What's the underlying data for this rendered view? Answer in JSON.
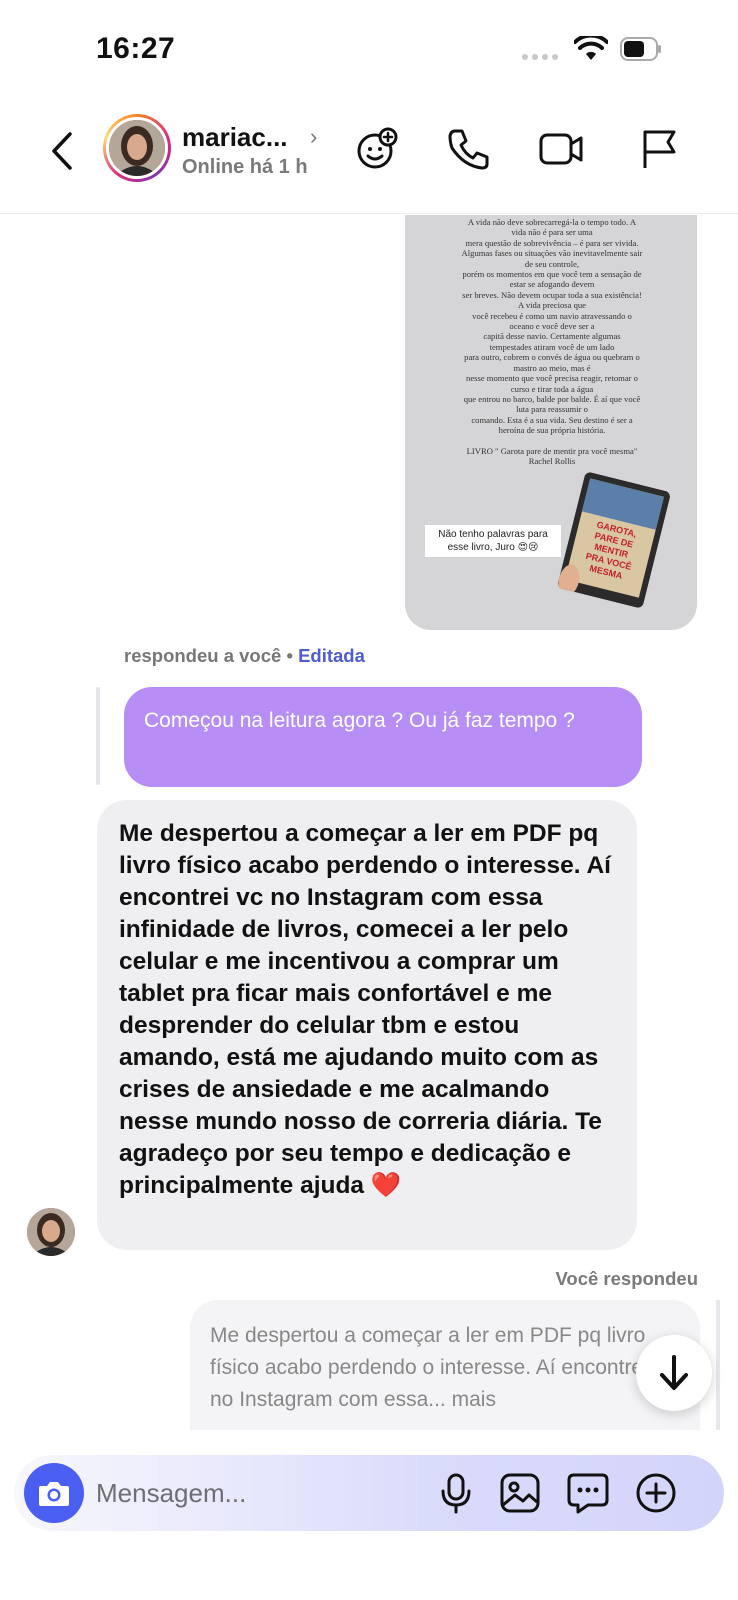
{
  "status_bar": {
    "time": "16:27"
  },
  "header": {
    "contact_name": "mariac...",
    "contact_status": "Online há 1 h",
    "icons": [
      "back-icon",
      "avatar",
      "sticker-icon",
      "phone-icon",
      "video-icon",
      "flag-icon"
    ]
  },
  "story": {
    "text_lines": [
      "A vida não deve sobrecarregá-la o tempo todo. A",
      "vida não é para ser uma",
      "mera questão de sobrevivência – é para ser vivida.",
      "Algumas fases ou situações vão inevitavelmente sair",
      "de seu controle,",
      "porém os momentos em que você tem a sensação de",
      "estar se afogando devem",
      "ser breves. Não devem ocupar toda a sua existência!",
      "A vida preciosa que",
      "você recebeu é como um navio atravessando o",
      "oceano e você deve ser a",
      "capitã desse navio. Certamente algumas",
      "tempestades atiram você de um lado",
      "para outro, cobrem o convés de água ou quebram o",
      "mastro ao meio, mas é",
      "nesse momento que você precisa reagir, retomar o",
      "curso e tirar toda a água",
      "que entrou no barco, balde por balde. É aí que você",
      "luta para reassumir o",
      "comando. Esta é a sua vida. Seu destino é ser a",
      "heroína de sua própria história.",
      "",
      "LIVRO \" Garota pare de mentir pra você mesma\"",
      "Rachel Rollis"
    ],
    "caption": "Não tenho palavras para esse livro, Juro 😍😢",
    "book_cover_text": "GAROTA, PARE DE MENTIR PRA VOCÊ MESMA"
  },
  "reply": {
    "meta": "respondeu a você",
    "separator": "•",
    "edited": "Editada",
    "quoted_text": "Começou na leitura agora ? Ou já faz tempo ?"
  },
  "message": {
    "text": "Me despertou a começar a ler em PDF pq livro físico acabo perdendo o interesse. Aí encontrei vc no Instagram com essa infinidade de livros, comecei a ler pelo celular e me incentivou a comprar um tablet pra ficar mais confortável e me desprender do celular tbm e estou amando, está me ajudando muito com as crises de ansiedade e me acalmando nesse mundo nosso de correria diária. Te agradeço por seu tempo e dedicação e principalmente ajuda ❤️"
  },
  "own_reply": {
    "label": "Você respondeu",
    "quoted_text": "Me despertou a começar a ler em PDF pq livro físico acabo perdendo o interesse. Aí encontrei vc no Instagram com essa... mais"
  },
  "composer": {
    "placeholder": "Mensagem...",
    "accent_color": "#4a5ef1"
  },
  "colors": {
    "quoted_bubble": "#b68ef5",
    "received_bubble": "#efeff2",
    "edited_link": "#4f5bd5"
  }
}
